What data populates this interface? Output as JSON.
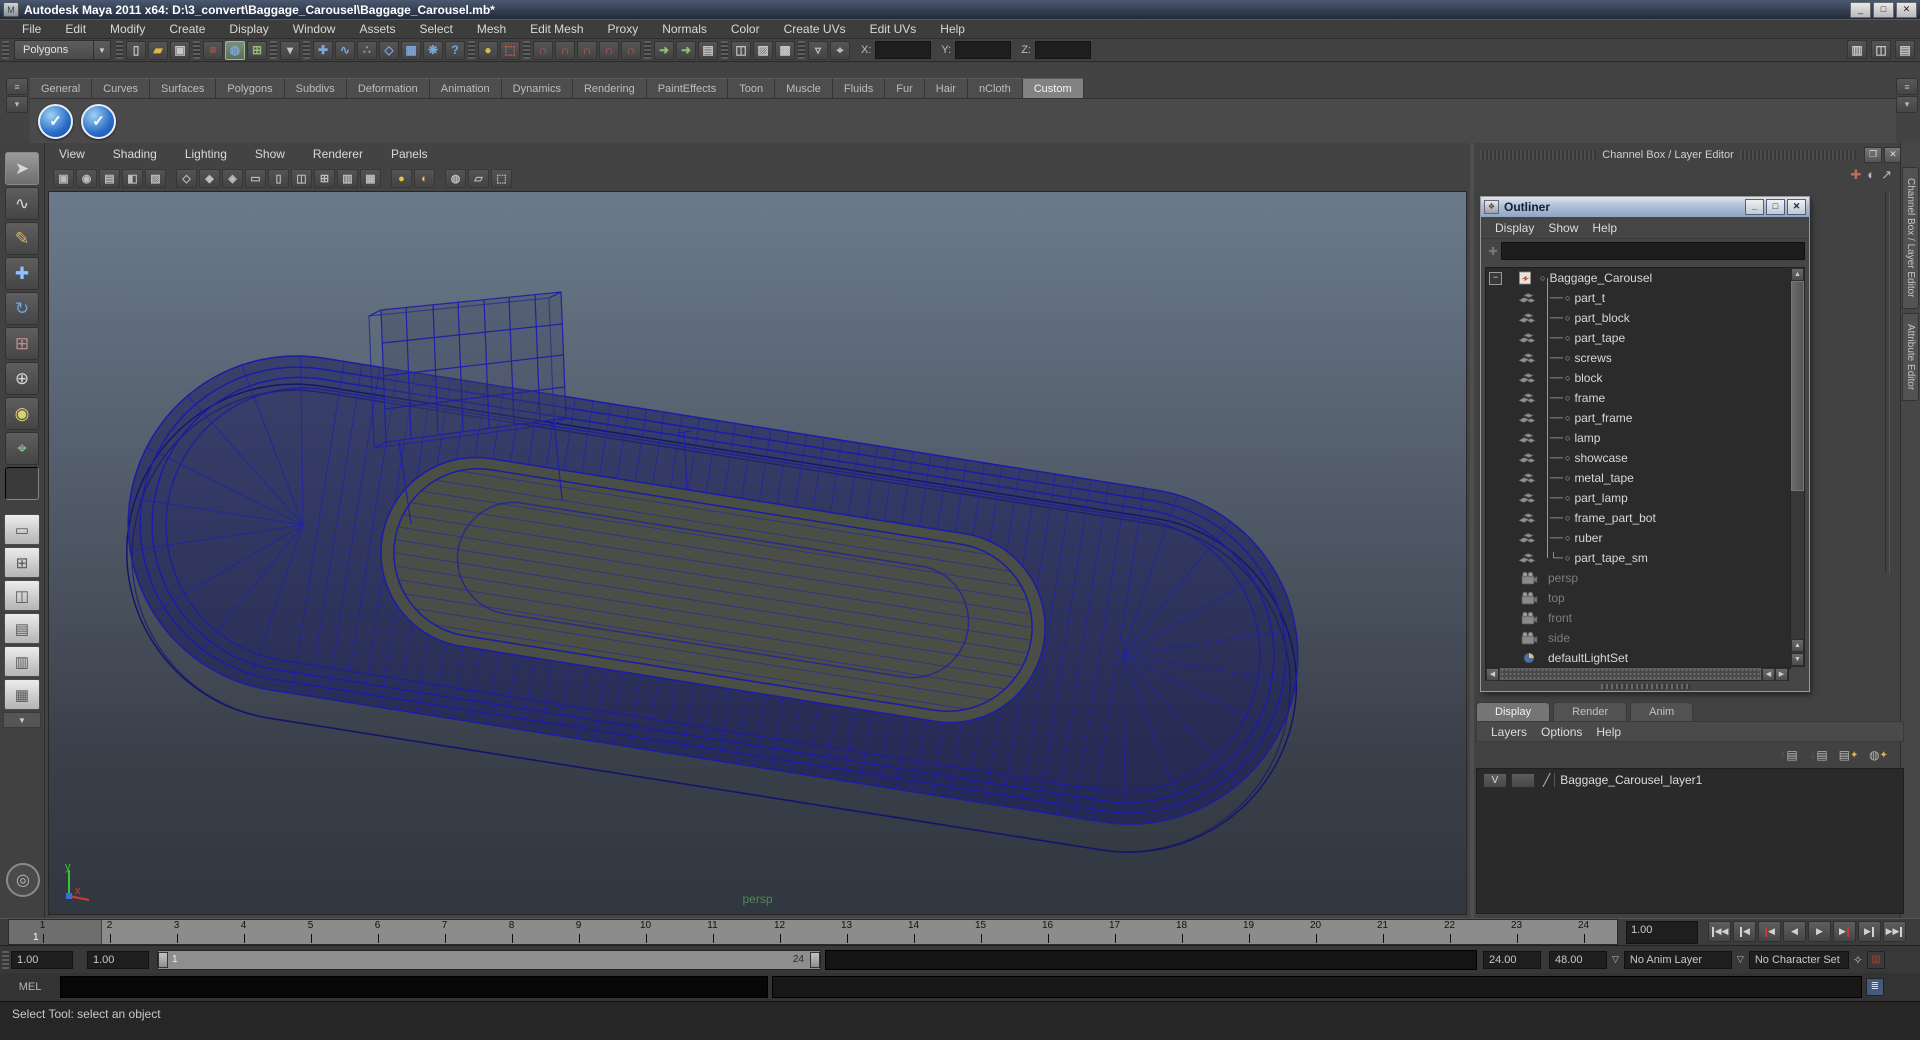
{
  "window": {
    "title": "Autodesk Maya 2011 x64: D:\\3_convert\\Baggage_Carousel\\Baggage_Carousel.mb*",
    "minimize": "_",
    "maximize": "□",
    "close": "✕"
  },
  "menubar": {
    "items": [
      "File",
      "Edit",
      "Modify",
      "Create",
      "Display",
      "Window",
      "Assets",
      "Select",
      "Mesh",
      "Edit Mesh",
      "Proxy",
      "Normals",
      "Color",
      "Create UVs",
      "Edit UVs",
      "Help"
    ]
  },
  "statusline": {
    "mode": "Polygons",
    "x_label": "X:",
    "y_label": "Y:",
    "z_label": "Z:"
  },
  "shelf": {
    "tabs": [
      "General",
      "Curves",
      "Surfaces",
      "Polygons",
      "Subdivs",
      "Deformation",
      "Animation",
      "Dynamics",
      "Rendering",
      "PaintEffects",
      "Toon",
      "Muscle",
      "Fluids",
      "Fur",
      "Hair",
      "nCloth",
      "Custom"
    ],
    "active_tab": "Custom"
  },
  "viewport": {
    "menu": [
      "View",
      "Shading",
      "Lighting",
      "Show",
      "Renderer",
      "Panels"
    ],
    "camera_label": "persp",
    "axis_y": "y",
    "axis_x": "x"
  },
  "right_panel": {
    "header": "Channel Box / Layer Editor",
    "tab_channel_box": "Channel Box / Layer Editor",
    "tab_attribute_editor": "Attribute Editor",
    "outliner": {
      "title": "Outliner",
      "menu": [
        "Display",
        "Show",
        "Help"
      ],
      "root": "Baggage_Carousel",
      "children": [
        "part_t",
        "part_block",
        "part_tape",
        "screws",
        "block",
        "frame",
        "part_frame",
        "lamp",
        "showcase",
        "metal_tape",
        "part_lamp",
        "frame_part_bot",
        "ruber",
        "part_tape_sm"
      ],
      "cameras": [
        "persp",
        "top",
        "front",
        "side"
      ],
      "sets": [
        "defaultLightSet"
      ]
    },
    "layer_editor": {
      "tabs": [
        "Display",
        "Render",
        "Anim"
      ],
      "active_tab": "Display",
      "menu": [
        "Layers",
        "Options",
        "Help"
      ],
      "layer_visible": "V",
      "layer_name": "Baggage_Carousel_layer1"
    }
  },
  "timeline": {
    "frames": [
      "1",
      "2",
      "3",
      "4",
      "5",
      "6",
      "7",
      "8",
      "9",
      "10",
      "11",
      "12",
      "13",
      "14",
      "15",
      "16",
      "17",
      "18",
      "19",
      "20",
      "21",
      "22",
      "23",
      "24"
    ],
    "current_frame": "1",
    "current_time": "1.00"
  },
  "range": {
    "anim_start": "1.00",
    "playback_start": "1.00",
    "bar_start": "1",
    "bar_end": "24",
    "playback_end": "24.00",
    "anim_end": "48.00",
    "anim_layer": "No Anim Layer",
    "character_set": "No Character Set"
  },
  "command_line": {
    "label": "MEL"
  },
  "help_line": {
    "text": "Select Tool: select an object"
  },
  "colors": {
    "wireframe": "#181b96",
    "viewport_top": "#6b7a8b",
    "viewport_bottom": "#313740",
    "shelf_item_blue": "#2a6cc8"
  }
}
